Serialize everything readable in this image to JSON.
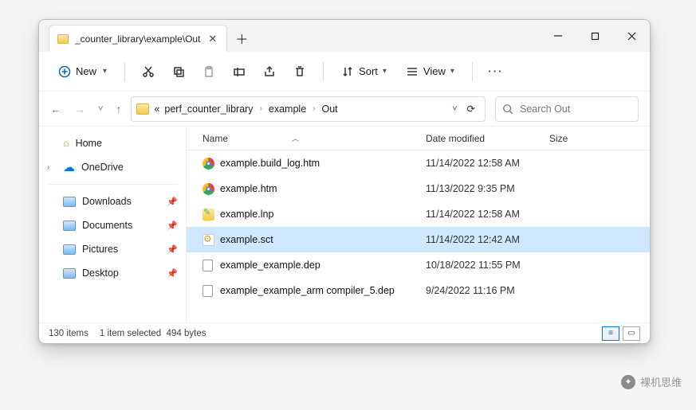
{
  "tab": {
    "title": "_counter_library\\example\\Out"
  },
  "toolbar": {
    "new_label": "New",
    "sort_label": "Sort",
    "view_label": "View"
  },
  "breadcrumb": {
    "overflow": "«",
    "items": [
      "perf_counter_library",
      "example",
      "Out"
    ]
  },
  "search": {
    "placeholder": "Search Out"
  },
  "sidebar": {
    "home": "Home",
    "onedrive": "OneDrive",
    "quick": [
      {
        "label": "Downloads"
      },
      {
        "label": "Documents"
      },
      {
        "label": "Pictures"
      },
      {
        "label": "Desktop"
      }
    ]
  },
  "columns": {
    "name": "Name",
    "date": "Date modified",
    "size": "Size"
  },
  "files": [
    {
      "icon": "chrome",
      "name": "example.build_log.htm",
      "date": "11/14/2022 12:58 AM",
      "selected": false
    },
    {
      "icon": "chrome",
      "name": "example.htm",
      "date": "11/13/2022 9:35 PM",
      "selected": false
    },
    {
      "icon": "lnp",
      "name": "example.lnp",
      "date": "11/14/2022 12:58 AM",
      "selected": false
    },
    {
      "icon": "sct",
      "name": "example.sct",
      "date": "11/14/2022 12:42 AM",
      "selected": true
    },
    {
      "icon": "file",
      "name": "example_example.dep",
      "date": "10/18/2022 11:55 PM",
      "selected": false
    },
    {
      "icon": "file",
      "name": "example_example_arm compiler_5.dep",
      "date": "9/24/2022 11:16 PM",
      "selected": false
    }
  ],
  "status": {
    "items": "130 items",
    "selection": "1 item selected",
    "size": "494 bytes"
  },
  "watermark": "裸机思维"
}
